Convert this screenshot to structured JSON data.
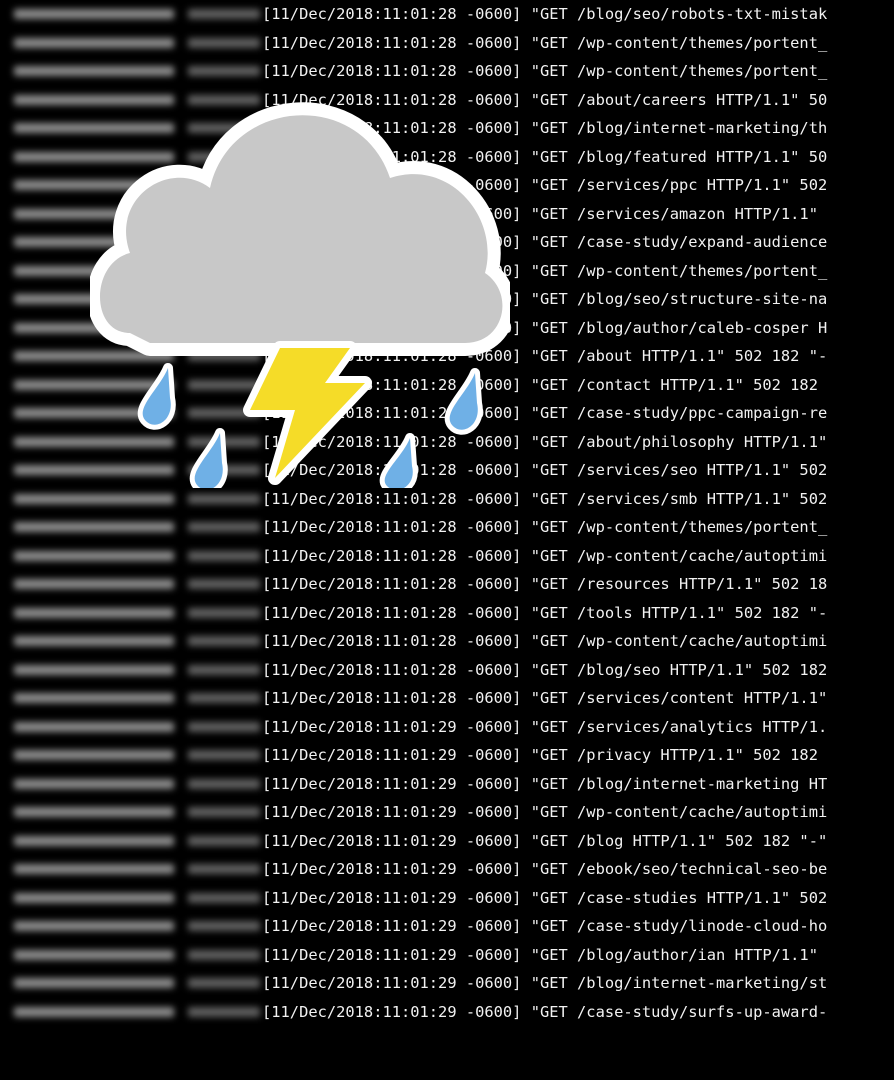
{
  "terminal": {
    "log_lines": [
      "[11/Dec/2018:11:01:28 -0600] \"GET /blog/seo/robots-txt-mistak",
      "[11/Dec/2018:11:01:28 -0600] \"GET /wp-content/themes/portent_",
      "[11/Dec/2018:11:01:28 -0600] \"GET /wp-content/themes/portent_",
      "[11/Dec/2018:11:01:28 -0600] \"GET /about/careers HTTP/1.1\" 50",
      "[11/Dec/2018:11:01:28 -0600] \"GET /blog/internet-marketing/th",
      "[11/Dec/2018:11:01:28 -0600] \"GET /blog/featured HTTP/1.1\" 50",
      "[11/Dec/2018:11:01:28 -0600] \"GET /services/ppc HTTP/1.1\" 502",
      "[11/Dec/2018:11:01:28 -0600] \"GET /services/amazon HTTP/1.1\" ",
      "[11/Dec/2018:11:01:28 -0600] \"GET /case-study/expand-audience",
      "[11/Dec/2018:11:01:28 -0600] \"GET /wp-content/themes/portent_",
      "[11/Dec/2018:11:01:28 -0600] \"GET /blog/seo/structure-site-na",
      "[11/Dec/2018:11:01:28 -0600] \"GET /blog/author/caleb-cosper H",
      "[11/Dec/2018:11:01:28 -0600] \"GET /about HTTP/1.1\" 502 182 \"-",
      "[11/Dec/2018:11:01:28 -0600] \"GET /contact HTTP/1.1\" 502 182 ",
      "[11/Dec/2018:11:01:28 -0600] \"GET /case-study/ppc-campaign-re",
      "[11/Dec/2018:11:01:28 -0600] \"GET /about/philosophy HTTP/1.1\"",
      "[11/Dec/2018:11:01:28 -0600] \"GET /services/seo HTTP/1.1\" 502",
      "[11/Dec/2018:11:01:28 -0600] \"GET /services/smb HTTP/1.1\" 502",
      "[11/Dec/2018:11:01:28 -0600] \"GET /wp-content/themes/portent_",
      "[11/Dec/2018:11:01:28 -0600] \"GET /wp-content/cache/autoptimi",
      "[11/Dec/2018:11:01:28 -0600] \"GET /resources HTTP/1.1\" 502 18",
      "[11/Dec/2018:11:01:28 -0600] \"GET /tools HTTP/1.1\" 502 182 \"-",
      "[11/Dec/2018:11:01:28 -0600] \"GET /wp-content/cache/autoptimi",
      "[11/Dec/2018:11:01:28 -0600] \"GET /blog/seo HTTP/1.1\" 502 182",
      "[11/Dec/2018:11:01:28 -0600] \"GET /services/content HTTP/1.1\"",
      "[11/Dec/2018:11:01:29 -0600] \"GET /services/analytics HTTP/1.",
      "[11/Dec/2018:11:01:29 -0600] \"GET /privacy HTTP/1.1\" 502 182 ",
      "[11/Dec/2018:11:01:29 -0600] \"GET /blog/internet-marketing HT",
      "[11/Dec/2018:11:01:29 -0600] \"GET /wp-content/cache/autoptimi",
      "[11/Dec/2018:11:01:29 -0600] \"GET /blog HTTP/1.1\" 502 182 \"-\"",
      "[11/Dec/2018:11:01:29 -0600] \"GET /ebook/seo/technical-seo-be",
      "[11/Dec/2018:11:01:29 -0600] \"GET /case-studies HTTP/1.1\" 502",
      "[11/Dec/2018:11:01:29 -0600] \"GET /case-study/linode-cloud-ho",
      "[11/Dec/2018:11:01:29 -0600] \"GET /blog/author/ian HTTP/1.1\" ",
      "[11/Dec/2018:11:01:29 -0600] \"GET /blog/internet-marketing/st",
      "[11/Dec/2018:11:01:29 -0600] \"GET /case-study/surfs-up-award-"
    ]
  },
  "overlay": {
    "icon": "cloud-with-lightning-and-rain-icon"
  },
  "colors": {
    "background": "#000000",
    "text": "#f2f2f2",
    "cloud": "#c8c8c8",
    "lightning": "#f5dc28",
    "raindrop": "#6fb0e6"
  }
}
